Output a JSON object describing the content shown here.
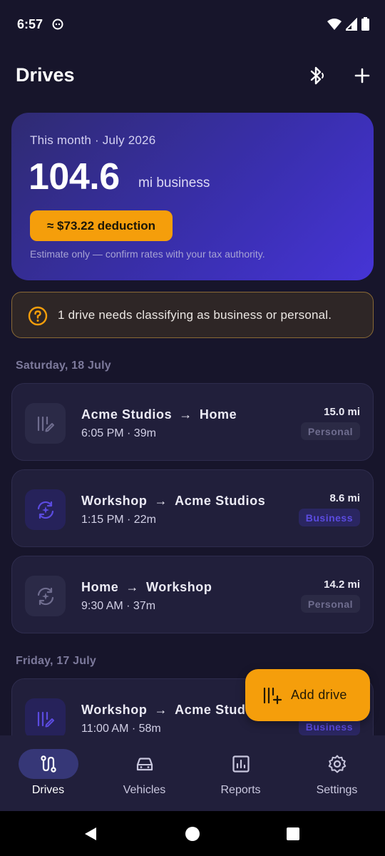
{
  "status_bar": {
    "time": "6:57"
  },
  "app_bar": {
    "title": "Drives"
  },
  "summary": {
    "period": "This month · July 2026",
    "value": "104.6",
    "unit": "mi business",
    "deduction": "≈ $73.22 deduction",
    "disclaimer": "Estimate only — confirm rates with your tax authority."
  },
  "alert": {
    "text": "1 drive needs classifying as business or personal."
  },
  "days": [
    {
      "label": "Saturday, 18 July",
      "drives": [
        {
          "from": "Acme Studios",
          "to": "Home",
          "meta": "6:05 PM · 39m",
          "distance": "15.0 mi",
          "tag": "Personal",
          "icon": "manual-entry-icon"
        },
        {
          "from": "Workshop",
          "to": "Acme Studios",
          "meta": "1:15 PM · 22m",
          "distance": "8.6 mi",
          "tag": "Business",
          "icon": "auto-detect-icon"
        },
        {
          "from": "Home",
          "to": "Workshop",
          "meta": "9:30 AM · 37m",
          "distance": "14.2 mi",
          "tag": "Personal",
          "icon": "auto-detect-icon"
        }
      ]
    },
    {
      "label": "Friday, 17 July",
      "drives": [
        {
          "from": "Workshop",
          "to": "Acme Studios",
          "meta": "11:00 AM · 58m",
          "distance": "",
          "tag": "Business",
          "icon": "manual-entry-icon"
        }
      ]
    }
  ],
  "arrow": "→",
  "fab": {
    "label": "Add drive"
  },
  "nav": [
    {
      "label": "Drives",
      "icon": "route-icon",
      "active": true
    },
    {
      "label": "Vehicles",
      "icon": "car-icon"
    },
    {
      "label": "Reports",
      "icon": "chart-icon"
    },
    {
      "label": "Settings",
      "icon": "gear-icon"
    }
  ],
  "colors": {
    "accent": "#f59e0b",
    "card": "#211f3b",
    "background": "#17152b",
    "business": "#5b4be0"
  }
}
